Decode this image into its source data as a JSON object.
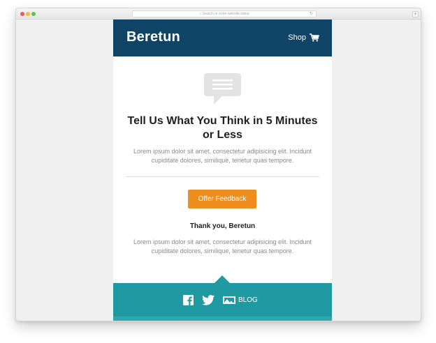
{
  "browser": {
    "url_placeholder": "Search or enter website name"
  },
  "header": {
    "brand": "Beretun",
    "shop_label": "Shop"
  },
  "main": {
    "headline": "Tell Us What You Think in 5 Minutes or Less",
    "intro": "Lorem ipsum dolor sit amet, consectetur adipisicing elit. Incidunt cupiditate dolores, similique, tenetur quas tempore.",
    "cta_label": "Offer Feedback",
    "thanks": "Thank you, Beretun",
    "outro": "Lorem ipsum dolor sit amet, consectetur adipisicing elit. Incidunt cupiditate dolores, similique, tenetur quas tempore."
  },
  "footer": {
    "blog_label": "BLOG",
    "icons": [
      "facebook-icon",
      "twitter-icon",
      "blog-icon"
    ]
  },
  "colors": {
    "header_bg": "#0f4466",
    "footer_bg": "#1f9aa2",
    "cta_bg": "#ed8e1f"
  }
}
